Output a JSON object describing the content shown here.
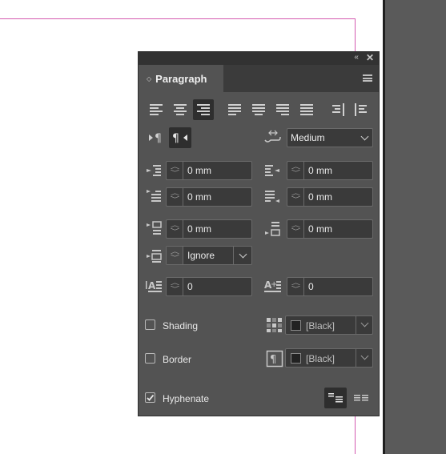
{
  "panel": {
    "title": "Paragraph",
    "tab_arrows": "◇",
    "collapse_glyph": "‹‹",
    "close_glyph": "✕"
  },
  "alignment_buttons": [
    {
      "name": "align-left",
      "selected": false
    },
    {
      "name": "align-center",
      "selected": false
    },
    {
      "name": "align-right",
      "selected": true
    },
    {
      "name": "justify-left",
      "selected": false
    },
    {
      "name": "justify-center",
      "selected": false
    },
    {
      "name": "justify-right",
      "selected": false
    },
    {
      "name": "justify-all",
      "selected": false
    },
    {
      "name": "align-toward-spine",
      "selected": false
    },
    {
      "name": "align-away-from-spine",
      "selected": false
    }
  ],
  "direction": {
    "ltr_selected": false,
    "rtl_selected": true
  },
  "kashida": {
    "value": "Medium"
  },
  "indents": {
    "left_indent": "0 mm",
    "right_indent": "0 mm",
    "first_line_indent": "0 mm",
    "last_line_indent": "0 mm",
    "space_before": "0 mm",
    "space_after": "0 mm",
    "align_to_grid": "Ignore"
  },
  "drop_cap": {
    "lines": "0",
    "characters": "0"
  },
  "shading": {
    "label": "Shading",
    "checked": false,
    "color": "[Black]"
  },
  "border": {
    "label": "Border",
    "checked": false,
    "color": "[Black]"
  },
  "hyphenate": {
    "label": "Hyphenate",
    "checked": true
  },
  "colors": {
    "panel_bg": "#535353",
    "titlebar_bg": "#323232",
    "field_bg": "#3a3a3a",
    "margin_guide": "#d45ab0",
    "pasteboard": "#5a5a5a"
  }
}
